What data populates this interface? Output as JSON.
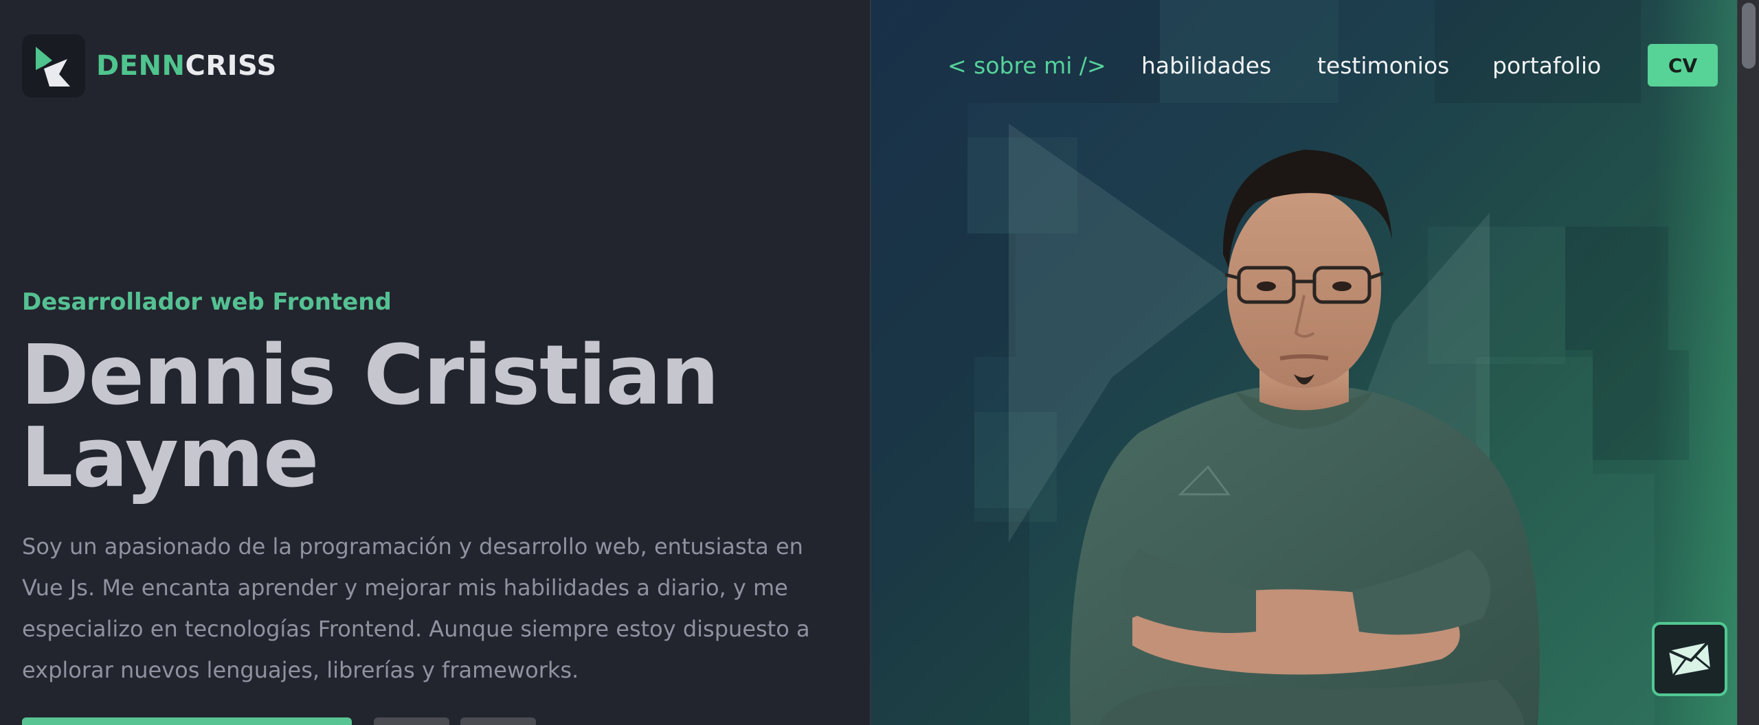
{
  "brand": {
    "part1": "DENN",
    "part2": "CRISS"
  },
  "nav": {
    "items": [
      {
        "label": "< sobre mi />",
        "active": true
      },
      {
        "label": "habilidades",
        "active": false
      },
      {
        "label": "testimonios",
        "active": false
      },
      {
        "label": "portafolio",
        "active": false
      }
    ],
    "cv_label": "CV"
  },
  "hero": {
    "subtitle": "Desarrollador web Frontend",
    "name_line1": "Dennis Cristian",
    "name_line2": "Layme",
    "bio": "Soy un apasionado de la programación y desarrollo web, entusiasta en Vue Js. Me encanta aprender y mejorar mis habilidades a diario, y me especializo en tecnologías Frontend. Aunque siempre estoy dispuesto a explorar nuevos lenguajes, librerías y frameworks."
  },
  "colors": {
    "accent": "#56d39a",
    "background": "#22252e",
    "cv_button": "#58d397"
  },
  "icons": {
    "logo": "brand-logo-icon",
    "mail": "mail-icon"
  }
}
